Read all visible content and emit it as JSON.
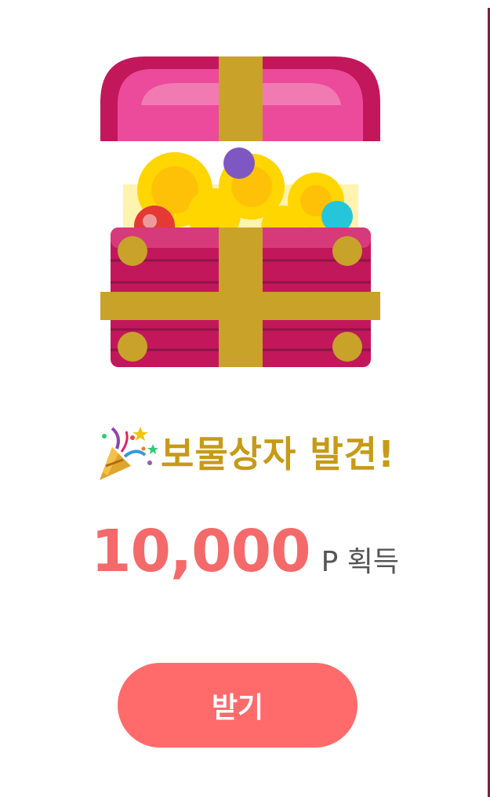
{
  "popup": {
    "title": "보물상자 발견!",
    "reward_amount": "10,000",
    "reward_suffix": "P 획득",
    "button_label": "받기"
  },
  "icons": {
    "chest": "treasure-chest-icon",
    "party": "party-popper-icon"
  },
  "colors": {
    "title": "#c79a17",
    "amount": "#f46a6a",
    "button": "#ff6b6b",
    "chest_body": "#c2185b",
    "chest_lid": "#e84393",
    "ribbon": "#c9a22a",
    "coin": "#ffd600"
  }
}
